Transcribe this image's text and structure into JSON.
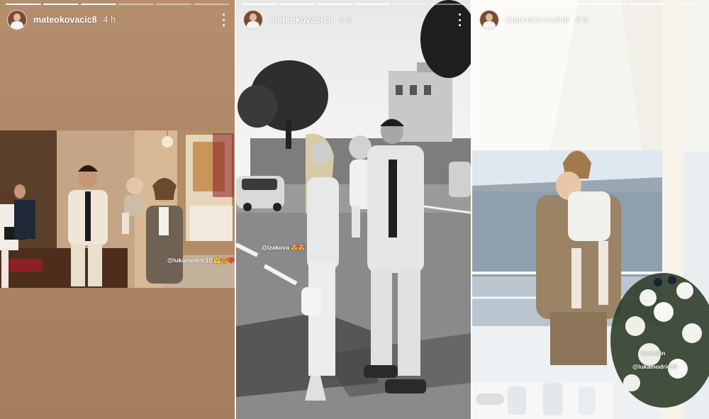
{
  "stories": [
    {
      "username": "mateokovacic8",
      "time": "4 h",
      "mention": "@lukamodric10",
      "emoji": "🤗😍❤️"
    },
    {
      "username": "mateokovacic8",
      "time": "4 h",
      "mention": "@izakova",
      "emoji": "😍😍"
    },
    {
      "username": "mateokovacic8",
      "time": "4 h",
      "caption": "kumašin",
      "mention": "@lukamodric10"
    }
  ],
  "icons": {
    "avatar": "profile-avatar",
    "more": "more-vertical-icon"
  }
}
